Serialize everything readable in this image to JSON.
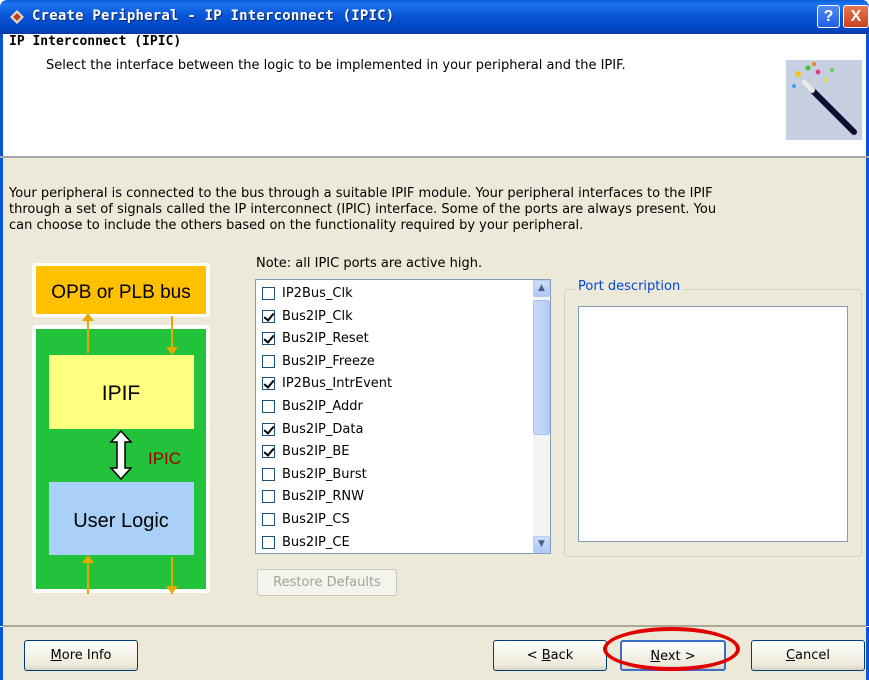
{
  "window": {
    "title": "Create Peripheral - IP Interconnect (IPIC)",
    "help_label": "?",
    "close_label": "X"
  },
  "header": {
    "title": "IP Interconnect (IPIC)",
    "subtitle": "Select the interface between the logic to be implemented in your peripheral and the IPIF."
  },
  "intro": {
    "line1": "Your peripheral is connected to the bus through a suitable IPIF module. Your peripheral interfaces to the IPIF",
    "line2": "through a set of signals called the IP interconnect (IPIC) interface. Some of the ports are always present. You",
    "line3": "can choose to include the others based on the functionality required by your peripheral."
  },
  "diagram": {
    "bus_label": "OPB or PLB bus",
    "ipif_label": "IPIF",
    "ipic_label": "IPIC",
    "user_logic_label": "User Logic",
    "colors": {
      "bus": "#ffc000",
      "frame": "#22c23a",
      "ipif": "#ffff80",
      "user": "#a8d0f8",
      "ipic": "#a00000"
    }
  },
  "ports": {
    "note": "Note: all IPIC ports are active high.",
    "items": [
      {
        "label": "IP2Bus_Clk",
        "checked": false
      },
      {
        "label": "Bus2IP_Clk",
        "checked": true
      },
      {
        "label": "Bus2IP_Reset",
        "checked": true
      },
      {
        "label": "Bus2IP_Freeze",
        "checked": false
      },
      {
        "label": "IP2Bus_IntrEvent",
        "checked": true
      },
      {
        "label": "Bus2IP_Addr",
        "checked": false
      },
      {
        "label": "Bus2IP_Data",
        "checked": true
      },
      {
        "label": "Bus2IP_BE",
        "checked": true
      },
      {
        "label": "Bus2IP_Burst",
        "checked": false
      },
      {
        "label": "Bus2IP_RNW",
        "checked": false
      },
      {
        "label": "Bus2IP_CS",
        "checked": false
      },
      {
        "label": "Bus2IP_CE",
        "checked": false
      }
    ],
    "restore_label": "Restore Defaults"
  },
  "port_description": {
    "legend": "Port description",
    "text": ""
  },
  "footer": {
    "more_info_pre": "",
    "more_info_key": "M",
    "more_info_post": "ore Info",
    "back_pre": "< ",
    "back_key": "B",
    "back_post": "ack",
    "next_pre": "",
    "next_key": "N",
    "next_post": "ext >",
    "cancel_pre": "",
    "cancel_key": "C",
    "cancel_post": "ancel"
  }
}
